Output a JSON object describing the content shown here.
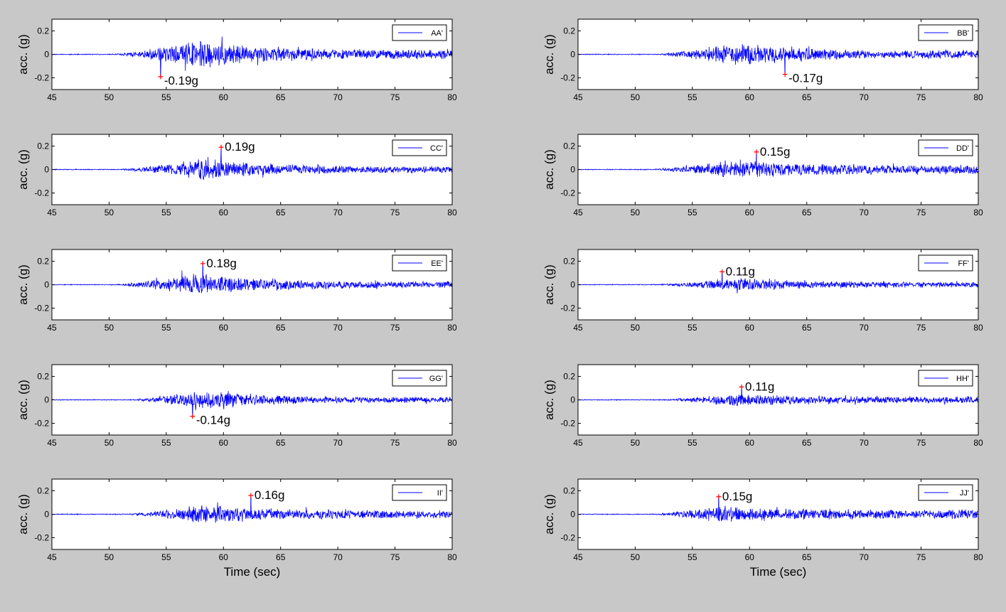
{
  "figure": {
    "background": "#c8c8c8",
    "plot_background": "#ffffff",
    "signal_color": "#0000ff",
    "peak_marker_color": "#ff0000"
  },
  "chart_data": [
    {
      "type": "line",
      "legend": "AA'",
      "ylabel": "acc. (g)",
      "xlabel": "",
      "xlim": [
        45,
        80
      ],
      "ylim": [
        -0.3,
        0.3
      ],
      "xticks": [
        "45",
        "50",
        "55",
        "60",
        "65",
        "70",
        "75",
        "80"
      ],
      "yticks": [
        "-0.2",
        "0",
        "0.2"
      ],
      "legend_position": "top-right",
      "peak": {
        "x": 54.5,
        "y": -0.19,
        "label": "-0.19g"
      },
      "envelope": {
        "start": 50.5,
        "center": 58,
        "end": 80,
        "max_amp": 0.13,
        "tail_amp": 0.04
      },
      "seed": 11
    },
    {
      "type": "line",
      "legend": "BB'",
      "ylabel": "acc. (g)",
      "xlabel": "",
      "xlim": [
        45,
        80
      ],
      "ylim": [
        -0.3,
        0.3
      ],
      "xticks": [
        "45",
        "50",
        "55",
        "60",
        "65",
        "70",
        "75",
        "80"
      ],
      "yticks": [
        "-0.2",
        "0",
        "0.2"
      ],
      "legend_position": "top-right",
      "peak": {
        "x": 63.1,
        "y": -0.17,
        "label": "-0.17g"
      },
      "envelope": {
        "start": 52,
        "center": 59,
        "end": 80,
        "max_amp": 0.11,
        "tail_amp": 0.035
      },
      "seed": 23
    },
    {
      "type": "line",
      "legend": "CC'",
      "ylabel": "acc. (g)",
      "xlabel": "",
      "xlim": [
        45,
        80
      ],
      "ylim": [
        -0.3,
        0.3
      ],
      "xticks": [
        "45",
        "50",
        "55",
        "60",
        "65",
        "70",
        "75",
        "80"
      ],
      "yticks": [
        "-0.2",
        "0",
        "0.2"
      ],
      "legend_position": "top-right",
      "peak": {
        "x": 59.8,
        "y": 0.19,
        "label": "0.19g"
      },
      "envelope": {
        "start": 51,
        "center": 58.5,
        "end": 80,
        "max_amp": 0.1,
        "tail_amp": 0.03
      },
      "seed": 37
    },
    {
      "type": "line",
      "legend": "DD'",
      "ylabel": "acc. (g)",
      "xlabel": "",
      "xlim": [
        45,
        80
      ],
      "ylim": [
        -0.3,
        0.3
      ],
      "xticks": [
        "45",
        "50",
        "55",
        "60",
        "65",
        "70",
        "75",
        "80"
      ],
      "yticks": [
        "-0.2",
        "0",
        "0.2"
      ],
      "legend_position": "top-right",
      "peak": {
        "x": 60.6,
        "y": 0.15,
        "label": "0.15g"
      },
      "envelope": {
        "start": 51.5,
        "center": 59,
        "end": 80,
        "max_amp": 0.09,
        "tail_amp": 0.04
      },
      "seed": 41
    },
    {
      "type": "line",
      "legend": "EE'",
      "ylabel": "acc. (g)",
      "xlabel": "",
      "xlim": [
        45,
        80
      ],
      "ylim": [
        -0.3,
        0.3
      ],
      "xticks": [
        "45",
        "50",
        "55",
        "60",
        "65",
        "70",
        "75",
        "80"
      ],
      "yticks": [
        "-0.2",
        "0",
        "0.2"
      ],
      "legend_position": "top-right",
      "peak": {
        "x": 58.2,
        "y": 0.18,
        "label": "0.18g"
      },
      "envelope": {
        "start": 50.5,
        "center": 58,
        "end": 80,
        "max_amp": 0.11,
        "tail_amp": 0.03
      },
      "seed": 53
    },
    {
      "type": "line",
      "legend": "FF'",
      "ylabel": "acc. (g)",
      "xlabel": "",
      "xlim": [
        45,
        80
      ],
      "ylim": [
        -0.3,
        0.3
      ],
      "xticks": [
        "45",
        "50",
        "55",
        "60",
        "65",
        "70",
        "75",
        "80"
      ],
      "yticks": [
        "-0.2",
        "0",
        "0.2"
      ],
      "legend_position": "top-right",
      "peak": {
        "x": 57.6,
        "y": 0.11,
        "label": "0.11g"
      },
      "envelope": {
        "start": 52,
        "center": 59,
        "end": 80,
        "max_amp": 0.06,
        "tail_amp": 0.025
      },
      "seed": 61
    },
    {
      "type": "line",
      "legend": "GG'",
      "ylabel": "acc. (g)",
      "xlabel": "",
      "xlim": [
        45,
        80
      ],
      "ylim": [
        -0.3,
        0.3
      ],
      "xticks": [
        "45",
        "50",
        "55",
        "60",
        "65",
        "70",
        "75",
        "80"
      ],
      "yticks": [
        "-0.2",
        "0",
        "0.2"
      ],
      "legend_position": "top-right",
      "peak": {
        "x": 57.3,
        "y": -0.14,
        "label": "-0.14g"
      },
      "envelope": {
        "start": 52,
        "center": 58.5,
        "end": 80,
        "max_amp": 0.09,
        "tail_amp": 0.025
      },
      "seed": 71
    },
    {
      "type": "line",
      "legend": "HH'",
      "ylabel": "acc. (g)",
      "xlabel": "",
      "xlim": [
        45,
        80
      ],
      "ylim": [
        -0.3,
        0.3
      ],
      "xticks": [
        "45",
        "50",
        "55",
        "60",
        "65",
        "70",
        "75",
        "80"
      ],
      "yticks": [
        "-0.2",
        "0",
        "0.2"
      ],
      "legend_position": "top-right",
      "peak": {
        "x": 59.3,
        "y": 0.11,
        "label": "0.11g"
      },
      "envelope": {
        "start": 52.5,
        "center": 59,
        "end": 80,
        "max_amp": 0.06,
        "tail_amp": 0.03
      },
      "seed": 83
    },
    {
      "type": "line",
      "legend": "II'",
      "ylabel": "acc. (g)",
      "xlabel": "Time (sec)",
      "xlim": [
        45,
        80
      ],
      "ylim": [
        -0.3,
        0.3
      ],
      "xticks": [
        "45",
        "50",
        "55",
        "60",
        "65",
        "70",
        "75",
        "80"
      ],
      "yticks": [
        "-0.2",
        "0",
        "0.2"
      ],
      "legend_position": "top-right",
      "peak": {
        "x": 62.4,
        "y": 0.16,
        "label": "0.16g"
      },
      "envelope": {
        "start": 51.5,
        "center": 58.5,
        "end": 80,
        "max_amp": 0.09,
        "tail_amp": 0.035
      },
      "seed": 97
    },
    {
      "type": "line",
      "legend": "JJ'",
      "ylabel": "acc. (g)",
      "xlabel": "Time (sec)",
      "xlim": [
        45,
        80
      ],
      "ylim": [
        -0.3,
        0.3
      ],
      "xticks": [
        "45",
        "50",
        "55",
        "60",
        "65",
        "70",
        "75",
        "80"
      ],
      "yticks": [
        "-0.2",
        "0",
        "0.2"
      ],
      "legend_position": "top-right",
      "peak": {
        "x": 57.3,
        "y": 0.15,
        "label": "0.15g"
      },
      "envelope": {
        "start": 51.5,
        "center": 58,
        "end": 80,
        "max_amp": 0.08,
        "tail_amp": 0.04
      },
      "seed": 103
    }
  ]
}
